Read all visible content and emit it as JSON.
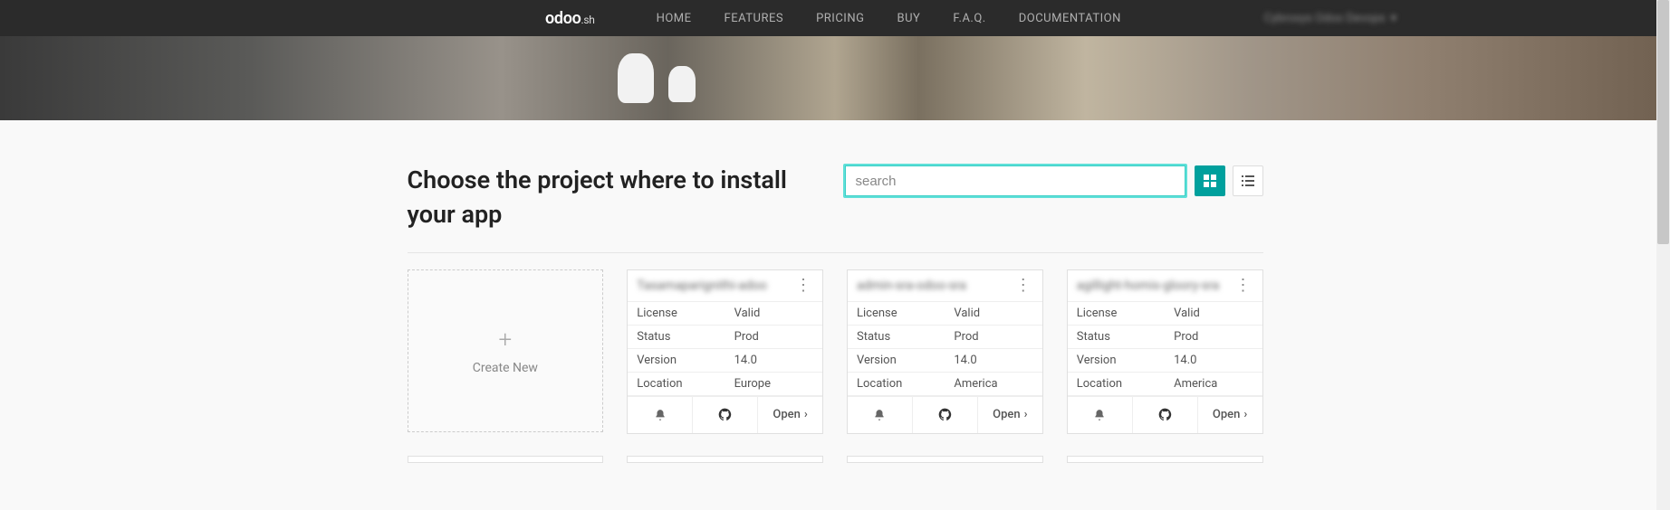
{
  "nav": {
    "logo_main": "odoo",
    "logo_suffix": ".sh",
    "links": [
      "HOME",
      "FEATURES",
      "PRICING",
      "BUY",
      "F.A.Q.",
      "DOCUMENTATION"
    ],
    "user_label": "Cybrosys Odoo Devops"
  },
  "page": {
    "title": "Choose the project where to install your app",
    "search_placeholder": "search",
    "create_new_label": "Create New"
  },
  "row_labels": {
    "license": "License",
    "status": "Status",
    "version": "Version",
    "location": "Location"
  },
  "open_label": "Open",
  "projects": [
    {
      "name": "Tasamaparignithi-adoo",
      "license": "Valid",
      "status": "Prod",
      "version": "14.0",
      "location": "Europe"
    },
    {
      "name": "admin-sra-odoo-sra",
      "license": "Valid",
      "status": "Prod",
      "version": "14.0",
      "location": "America"
    },
    {
      "name": "agillight-homis-gloory-sra",
      "license": "Valid",
      "status": "Prod",
      "version": "14.0",
      "location": "America"
    }
  ]
}
